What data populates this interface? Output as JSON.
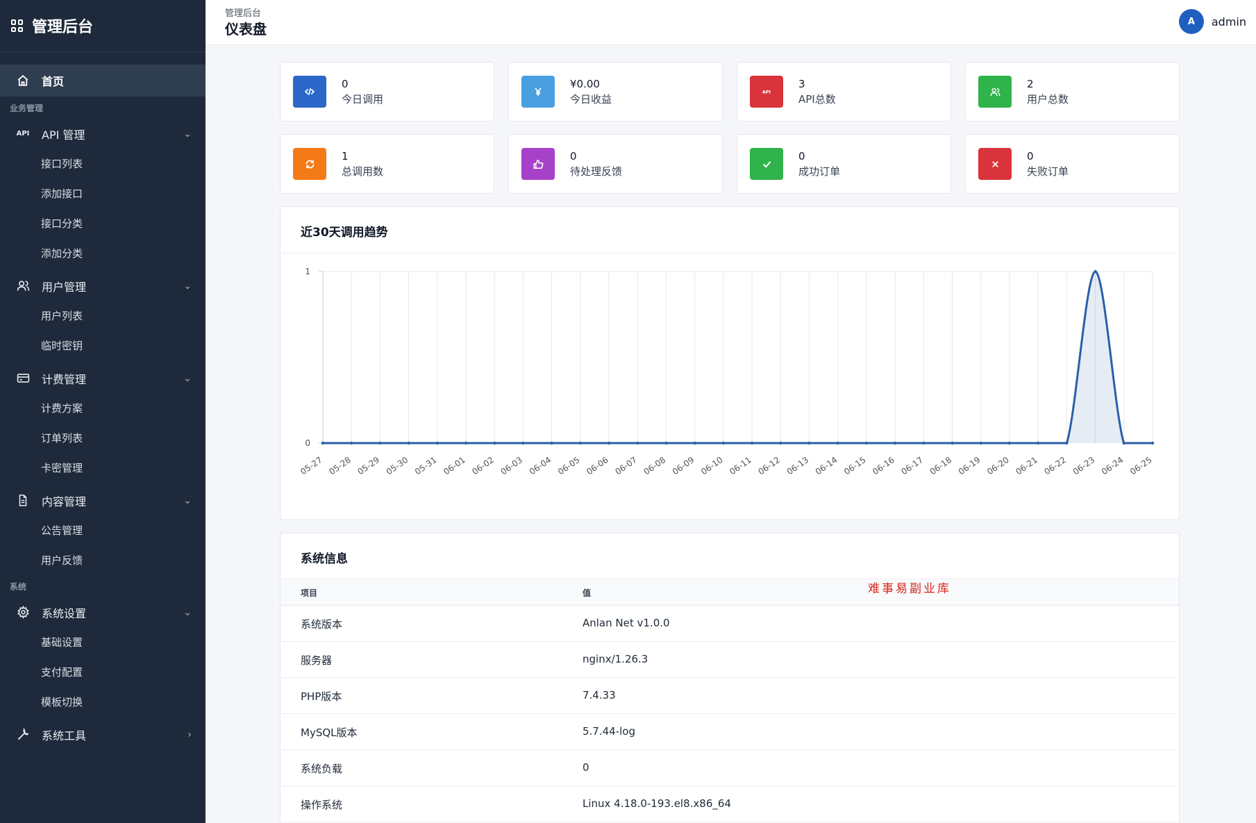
{
  "brand": {
    "title": "管理后台"
  },
  "sidebar": {
    "home": "首页",
    "section_business": "业务管理",
    "api_mgmt": {
      "icon_text": "API",
      "label": "API 管理",
      "items": [
        "接口列表",
        "添加接口",
        "接口分类",
        "添加分类"
      ]
    },
    "user_mgmt": {
      "label": "用户管理",
      "items": [
        "用户列表",
        "临时密钥"
      ]
    },
    "billing_mgmt": {
      "label": "计费管理",
      "items": [
        "计费方案",
        "订单列表",
        "卡密管理"
      ]
    },
    "content_mgmt": {
      "label": "内容管理",
      "items": [
        "公告管理",
        "用户反馈"
      ]
    },
    "section_system": "系统",
    "system_settings": {
      "label": "系统设置",
      "items": [
        "基础设置",
        "支付配置",
        "模板切换"
      ]
    },
    "system_tools": {
      "label": "系统工具"
    }
  },
  "header": {
    "breadcrumb": "管理后台",
    "title": "仪表盘",
    "avatar_letter": "A",
    "username": "admin"
  },
  "stats": [
    {
      "value": "0",
      "label": "今日调用",
      "icon": "code-icon",
      "color": "#2a67c9"
    },
    {
      "value": "¥0.00",
      "label": "今日收益",
      "icon": "yen-icon",
      "color": "#4a9fe0"
    },
    {
      "value": "3",
      "label": "API总数",
      "icon": "api-icon",
      "color": "#d9343b"
    },
    {
      "value": "2",
      "label": "用户总数",
      "icon": "users-icon",
      "color": "#2fb34a"
    },
    {
      "value": "1",
      "label": "总调用数",
      "icon": "refresh-icon",
      "color": "#f47a17"
    },
    {
      "value": "0",
      "label": "待处理反馈",
      "icon": "thumbs-up-icon",
      "color": "#a841c9"
    },
    {
      "value": "0",
      "label": "成功订单",
      "icon": "check-icon",
      "color": "#2fb34a"
    },
    {
      "value": "0",
      "label": "失败订单",
      "icon": "close-icon",
      "color": "#d9343b"
    }
  ],
  "chart_title": "近30天调用趋势",
  "chart_data": {
    "type": "line",
    "title": "近30天调用趋势",
    "x": [
      "05-27",
      "05-28",
      "05-29",
      "05-30",
      "05-31",
      "06-01",
      "06-02",
      "06-03",
      "06-04",
      "06-05",
      "06-06",
      "06-07",
      "06-08",
      "06-09",
      "06-10",
      "06-11",
      "06-12",
      "06-13",
      "06-14",
      "06-15",
      "06-16",
      "06-17",
      "06-18",
      "06-19",
      "06-20",
      "06-21",
      "06-22",
      "06-23",
      "06-24",
      "06-25"
    ],
    "series": [
      {
        "values": [
          0,
          0,
          0,
          0,
          0,
          0,
          0,
          0,
          0,
          0,
          0,
          0,
          0,
          0,
          0,
          0,
          0,
          0,
          0,
          0,
          0,
          0,
          0,
          0,
          0,
          0,
          0,
          1,
          0,
          0
        ]
      }
    ],
    "yticks": [
      "0",
      "1"
    ],
    "ylim": [
      0,
      1
    ],
    "grid": true,
    "line_color": "#2a5fa8"
  },
  "system_info": {
    "title": "系统信息",
    "col_item": "项目",
    "col_value": "值",
    "rows": [
      {
        "item": "系统版本",
        "value": "Anlan Net v1.0.0"
      },
      {
        "item": "服务器",
        "value": "nginx/1.26.3"
      },
      {
        "item": "PHP版本",
        "value": "7.4.33"
      },
      {
        "item": "MySQL版本",
        "value": "5.7.44-log"
      },
      {
        "item": "系统负载",
        "value": "0"
      },
      {
        "item": "操作系统",
        "value": "Linux 4.18.0-193.el8.x86_64"
      }
    ]
  },
  "watermark": "难事易副业库"
}
